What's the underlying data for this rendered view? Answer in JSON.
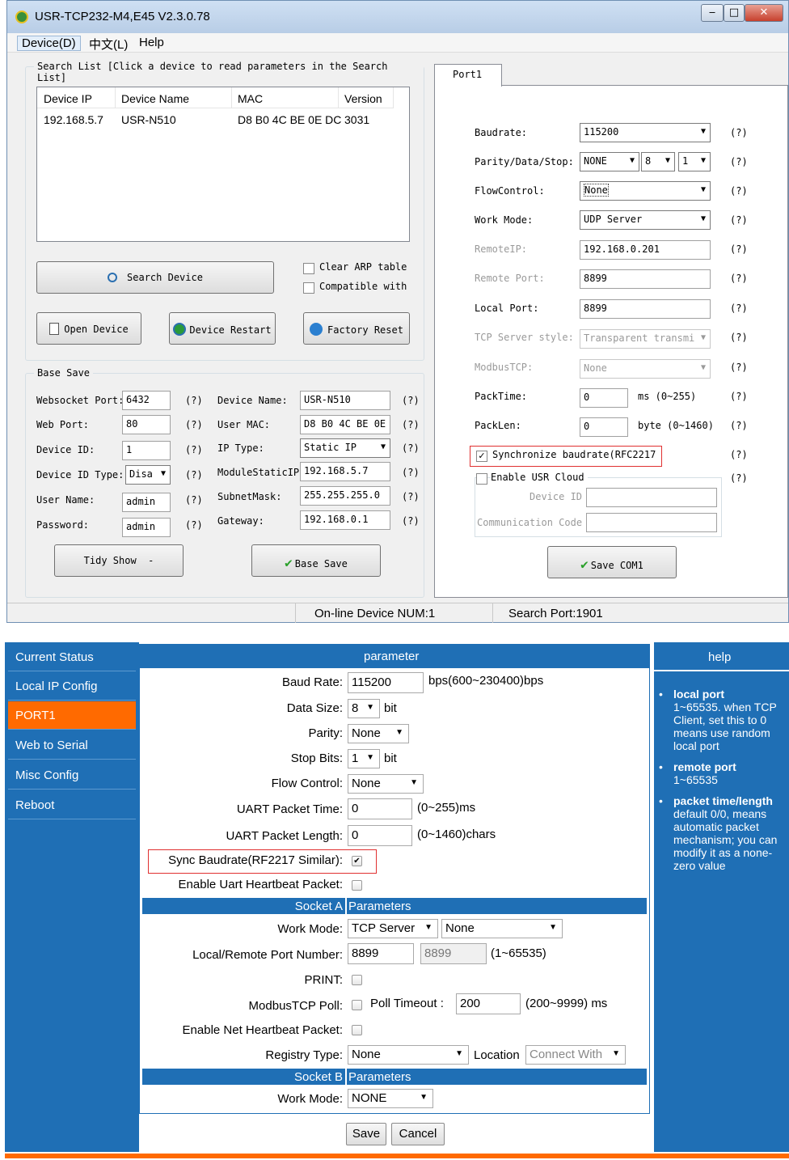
{
  "win": {
    "title": "USR-TCP232-M4,E45 V2.3.0.78",
    "min": "‒",
    "max": "□",
    "close": "✕"
  },
  "menu": {
    "device": "Device(D)",
    "chinese": "中文(L)",
    "help": "Help"
  },
  "search_list": {
    "legend": "Search List [Click a device to read parameters in the Search List]",
    "headers": [
      "Device IP",
      "Device Name",
      "MAC",
      "Version"
    ],
    "rows": [
      [
        "192.168.5.7",
        "USR-N510",
        "D8 B0 4C BE 0E DC",
        "3031"
      ]
    ]
  },
  "buttons": {
    "search": "Search Device",
    "clear_arp": "Clear ARP table",
    "compatible": "Compatible with",
    "open": "Open Device",
    "restart": "Device Restart",
    "factory": "Factory Reset",
    "tidy": "Tidy Show  -",
    "base_save": "Base Save",
    "save_com": "Save COM1"
  },
  "base_save": {
    "legend": "Base Save",
    "websocket_label": "Websocket Port:",
    "websocket": "6432",
    "webport_label": "Web Port:",
    "webport": "80",
    "devid_label": "Device ID:",
    "devid": "1",
    "devtype_label": "Device ID Type:",
    "devtype": "Disa",
    "user_label": "User Name:",
    "user": "admin",
    "pass_label": "Password:",
    "pass": "admin",
    "devname_label": "Device Name:",
    "devname": "USR-N510",
    "mac_label": "User MAC:",
    "mac": "D8 B0 4C BE 0E",
    "ip_label": "IP    Type:",
    "iptype": "Static IP",
    "static_label": "ModuleStaticIP",
    "static": "192.168.5.7",
    "mask_label": "SubnetMask:",
    "mask": "255.255.255.0",
    "gw_label": "Gateway:",
    "gw": "192.168.0.1",
    "q": "(?)"
  },
  "port": {
    "tab": "Port1",
    "baud_label": "Baudrate:",
    "baud": "115200",
    "parity_label": "Parity/Data/Stop:",
    "parity": "NONE",
    "data": "8",
    "stop": "1",
    "flow_label": "FlowControl:",
    "flow": "None",
    "mode_label": "Work Mode:",
    "mode": "UDP Server",
    "rip_label": "RemoteIP:",
    "rip": "192.168.0.201",
    "rport_label": "Remote Port:",
    "rport": "8899",
    "lport_label": "Local Port:",
    "lport": "8899",
    "tcp_label": "TCP Server style:",
    "tcp": "Transparent transmi",
    "modbus_label": "ModbusTCP:",
    "modbus": "None",
    "packtime_label": "PackTime:",
    "packtime": "0",
    "packtime_unit": "ms (0~255)",
    "packlen_label": "PackLen:",
    "packlen": "0",
    "packlen_unit": "byte (0~1460)",
    "sync": "Synchronize baudrate(RFC2217",
    "cloud": "Enable USR Cloud",
    "cloud_devid": "Device ID",
    "cloud_code": "Communication Code",
    "q": "(?)",
    "check": "✓"
  },
  "status": {
    "online": "On-line Device NUM:1",
    "search_port": "Search Port:1901"
  },
  "web": {
    "nav": [
      "Current Status",
      "Local IP Config",
      "PORT1",
      "Web to Serial",
      "Misc Config",
      "Reboot"
    ],
    "param_title": "parameter",
    "help_title": "help",
    "help": [
      {
        "title": "local port",
        "text": "1~65535. when TCP Client, set this to 0 means use random local port"
      },
      {
        "title": "remote port",
        "text": "1~65535"
      },
      {
        "title": "packet time/length",
        "text": "default 0/0, means automatic packet mechanism; you can modify it as a none-zero value"
      }
    ],
    "baud_label": "Baud Rate:",
    "baud": "115200",
    "baud_unit": "bps(600~230400)bps",
    "datasize_label": "Data Size:",
    "datasize": "8",
    "bit": "bit",
    "parity_label": "Parity:",
    "parity": "None",
    "stop_label": "Stop Bits:",
    "stop": "1",
    "flow_label": "Flow Control:",
    "flow": "None",
    "ptime_label": "UART Packet Time:",
    "ptime": "0",
    "ptime_unit": "(0~255)ms",
    "plen_label": "UART Packet Length:",
    "plen": "0",
    "plen_unit": "(0~1460)chars",
    "sync_label": "Sync Baudrate(RF2217 Similar):",
    "uhb_label": "Enable Uart Heartbeat Packet:",
    "socketA": "Socket A",
    "parameters": "Parameters",
    "mode_label": "Work Mode:",
    "mode": "TCP Server",
    "mode2": "None",
    "lrport_label": "Local/Remote Port Number:",
    "lport": "8899",
    "rport": "8899",
    "port_range": "(1~65535)",
    "print_label": "PRINT:",
    "mbpoll_label": "ModbusTCP Poll:",
    "poll_timeout_label": "Poll Timeout :",
    "poll_timeout": "200",
    "poll_range": "(200~9999) ms",
    "nhb_label": "Enable Net Heartbeat Packet:",
    "reg_label": "Registry Type:",
    "reg": "None",
    "location": "Location",
    "connect": "Connect With",
    "socketB": "Socket B",
    "modeB": "NONE",
    "save": "Save",
    "cancel": "Cancel",
    "check": "✔"
  },
  "colors": {
    "blue": "#1f6fb5",
    "orange": "#ff6a00",
    "red_box": "#e03030"
  }
}
